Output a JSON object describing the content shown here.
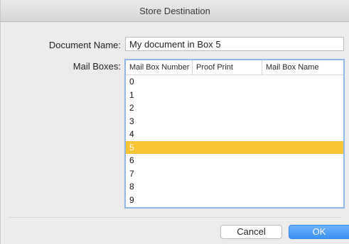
{
  "window": {
    "title": "Store Destination"
  },
  "form": {
    "document_name_label": "Document Name:",
    "document_name_value": "My document in Box 5",
    "mail_boxes_label": "Mail Boxes:"
  },
  "table": {
    "columns": [
      "Mail Box Number",
      "Proof Print",
      "Mail Box Name"
    ],
    "rows": [
      "0",
      "1",
      "2",
      "3",
      "4",
      "5",
      "6",
      "7",
      "8",
      "9"
    ],
    "selected_index": 5
  },
  "buttons": {
    "cancel": "Cancel",
    "ok": "OK"
  },
  "colors": {
    "selection": "#f8c334",
    "accent": "#3b92f3"
  }
}
